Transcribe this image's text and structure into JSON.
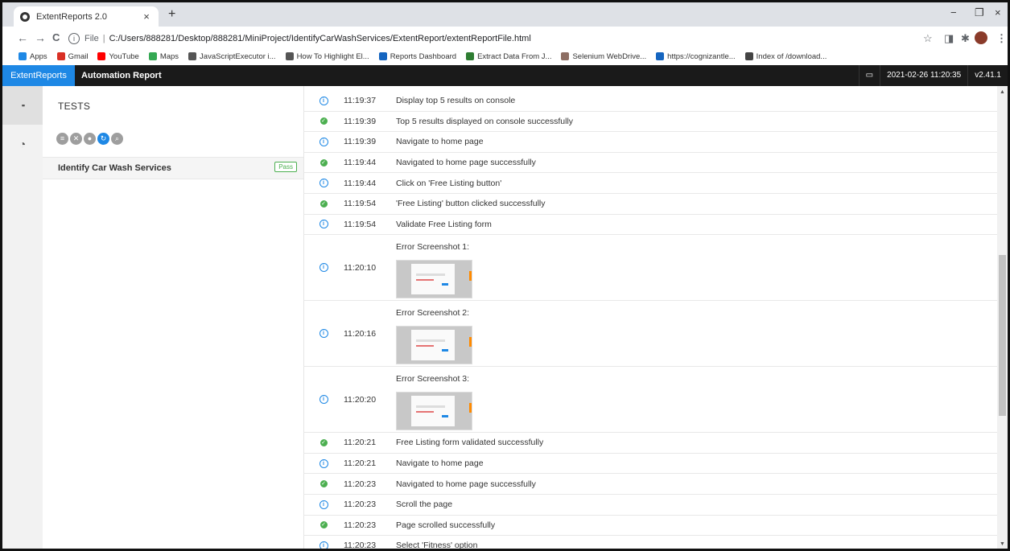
{
  "browser": {
    "tab_title": "ExtentReports 2.0",
    "tab_close": "×",
    "new_tab": "+",
    "address": {
      "scheme": "File",
      "url": "C:/Users/888281/Desktop/888281/MiniProject/IdentifyCarWashServices/ExtentReport/extentReportFile.html"
    },
    "nav": {
      "back": "←",
      "forward": "→",
      "reload": "C"
    },
    "window": {
      "minimize": "−",
      "restore": "❐",
      "close": "×"
    },
    "toolbar_right": {
      "star": "☆",
      "ext1": "◨",
      "ext2": "✱",
      "menu": "⋮"
    },
    "bookmarks": [
      {
        "label": "Apps",
        "color": "#1e88e5"
      },
      {
        "label": "Gmail",
        "color": "#d93025"
      },
      {
        "label": "YouTube",
        "color": "#ff0000"
      },
      {
        "label": "Maps",
        "color": "#34a853"
      },
      {
        "label": "JavaScriptExecutor i...",
        "color": "#555555"
      },
      {
        "label": "How To Highlight El...",
        "color": "#555555"
      },
      {
        "label": "Reports Dashboard",
        "color": "#1565c0"
      },
      {
        "label": "Extract Data From J...",
        "color": "#2e7d32"
      },
      {
        "label": "Selenium WebDrive...",
        "color": "#8d6e63"
      },
      {
        "label": "https://cognizantle...",
        "color": "#1565c0"
      },
      {
        "label": "Index of /download...",
        "color": "#444444"
      }
    ]
  },
  "app": {
    "brand": "ExtentReports",
    "report_name": "Automation Report",
    "datetime": "2021-02-26 11:20:35",
    "version": "v2.41.1",
    "monitor_icon": "▭"
  },
  "sidenav": {
    "tests_icon": "▪▪",
    "dashboard_icon": "◔"
  },
  "tests_panel": {
    "title": "TESTS",
    "filters": [
      {
        "glyph": "≡",
        "name": "filter-all-icon"
      },
      {
        "glyph": "✕",
        "name": "filter-fail-icon"
      },
      {
        "glyph": "●",
        "name": "filter-status-icon"
      },
      {
        "glyph": "↻",
        "name": "filter-refresh-icon"
      },
      {
        "glyph": "⌕",
        "name": "filter-search-icon"
      }
    ],
    "test": {
      "name": "Identify Car Wash Services",
      "status": "Pass"
    }
  },
  "log": {
    "rows_top": [
      {
        "status": "info",
        "time": "11:19:37",
        "detail": "Display top 5 results on console"
      },
      {
        "status": "pass",
        "time": "11:19:39",
        "detail": "Top 5 results displayed on console successfully"
      },
      {
        "status": "info",
        "time": "11:19:39",
        "detail": "Navigate to home page"
      },
      {
        "status": "pass",
        "time": "11:19:44",
        "detail": "Navigated to home page successfully"
      },
      {
        "status": "info",
        "time": "11:19:44",
        "detail": "Click on 'Free Listing button'"
      },
      {
        "status": "pass",
        "time": "11:19:54",
        "detail": "'Free Listing' button clicked successfully"
      },
      {
        "status": "info",
        "time": "11:19:54",
        "detail": "Validate Free Listing form"
      }
    ],
    "screenshots": [
      {
        "status": "info",
        "time": "11:20:10",
        "detail": "Error Screenshot 1:"
      },
      {
        "status": "info",
        "time": "11:20:16",
        "detail": "Error Screenshot 2:"
      },
      {
        "status": "info",
        "time": "11:20:20",
        "detail": "Error Screenshot 3:"
      }
    ],
    "rows_bottom": [
      {
        "status": "pass",
        "time": "11:20:21",
        "detail": "Free Listing form validated successfully"
      },
      {
        "status": "info",
        "time": "11:20:21",
        "detail": "Navigate to home page"
      },
      {
        "status": "pass",
        "time": "11:20:23",
        "detail": "Navigated to home page successfully"
      },
      {
        "status": "info",
        "time": "11:20:23",
        "detail": "Scroll the page"
      },
      {
        "status": "pass",
        "time": "11:20:23",
        "detail": "Page scrolled successfully"
      },
      {
        "status": "info",
        "time": "11:20:23",
        "detail": "Select 'Fitness' option"
      }
    ]
  }
}
